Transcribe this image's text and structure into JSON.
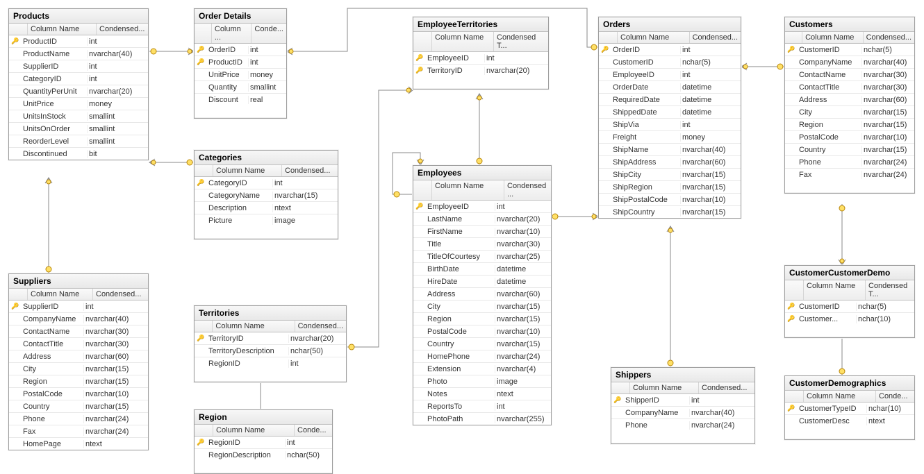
{
  "header_col1": "Column Name",
  "header_col1_short": "Column ...",
  "header_col2": "Condensed...",
  "header_col2_short": "Conde...",
  "header_col2_mid": "Condensed T...",
  "header_col2_mid2": "Condensed ...",
  "tables": {
    "products": {
      "title": "Products",
      "columns": [
        {
          "pk": true,
          "name": "ProductID",
          "type": "int"
        },
        {
          "pk": false,
          "name": "ProductName",
          "type": "nvarchar(40)"
        },
        {
          "pk": false,
          "name": "SupplierID",
          "type": "int"
        },
        {
          "pk": false,
          "name": "CategoryID",
          "type": "int"
        },
        {
          "pk": false,
          "name": "QuantityPerUnit",
          "type": "nvarchar(20)"
        },
        {
          "pk": false,
          "name": "UnitPrice",
          "type": "money"
        },
        {
          "pk": false,
          "name": "UnitsInStock",
          "type": "smallint"
        },
        {
          "pk": false,
          "name": "UnitsOnOrder",
          "type": "smallint"
        },
        {
          "pk": false,
          "name": "ReorderLevel",
          "type": "smallint"
        },
        {
          "pk": false,
          "name": "Discontinued",
          "type": "bit"
        }
      ]
    },
    "suppliers": {
      "title": "Suppliers",
      "columns": [
        {
          "pk": true,
          "name": "SupplierID",
          "type": "int"
        },
        {
          "pk": false,
          "name": "CompanyName",
          "type": "nvarchar(40)"
        },
        {
          "pk": false,
          "name": "ContactName",
          "type": "nvarchar(30)"
        },
        {
          "pk": false,
          "name": "ContactTitle",
          "type": "nvarchar(30)"
        },
        {
          "pk": false,
          "name": "Address",
          "type": "nvarchar(60)"
        },
        {
          "pk": false,
          "name": "City",
          "type": "nvarchar(15)"
        },
        {
          "pk": false,
          "name": "Region",
          "type": "nvarchar(15)"
        },
        {
          "pk": false,
          "name": "PostalCode",
          "type": "nvarchar(10)"
        },
        {
          "pk": false,
          "name": "Country",
          "type": "nvarchar(15)"
        },
        {
          "pk": false,
          "name": "Phone",
          "type": "nvarchar(24)"
        },
        {
          "pk": false,
          "name": "Fax",
          "type": "nvarchar(24)"
        },
        {
          "pk": false,
          "name": "HomePage",
          "type": "ntext"
        }
      ]
    },
    "orderdetails": {
      "title": "Order Details",
      "columns": [
        {
          "pk": true,
          "name": "OrderID",
          "type": "int"
        },
        {
          "pk": true,
          "name": "ProductID",
          "type": "int"
        },
        {
          "pk": false,
          "name": "UnitPrice",
          "type": "money"
        },
        {
          "pk": false,
          "name": "Quantity",
          "type": "smallint"
        },
        {
          "pk": false,
          "name": "Discount",
          "type": "real"
        }
      ]
    },
    "categories": {
      "title": "Categories",
      "columns": [
        {
          "pk": true,
          "name": "CategoryID",
          "type": "int"
        },
        {
          "pk": false,
          "name": "CategoryName",
          "type": "nvarchar(15)"
        },
        {
          "pk": false,
          "name": "Description",
          "type": "ntext"
        },
        {
          "pk": false,
          "name": "Picture",
          "type": "image"
        }
      ]
    },
    "territories": {
      "title": "Territories",
      "columns": [
        {
          "pk": true,
          "name": "TerritoryID",
          "type": "nvarchar(20)"
        },
        {
          "pk": false,
          "name": "TerritoryDescription",
          "type": "nchar(50)"
        },
        {
          "pk": false,
          "name": "RegionID",
          "type": "int"
        }
      ]
    },
    "region": {
      "title": "Region",
      "columns": [
        {
          "pk": true,
          "name": "RegionID",
          "type": "int"
        },
        {
          "pk": false,
          "name": "RegionDescription",
          "type": "nchar(50)"
        }
      ]
    },
    "employeeterritories": {
      "title": "EmployeeTerritories",
      "columns": [
        {
          "pk": true,
          "name": "EmployeeID",
          "type": "int"
        },
        {
          "pk": true,
          "name": "TerritoryID",
          "type": "nvarchar(20)"
        }
      ]
    },
    "employees": {
      "title": "Employees",
      "columns": [
        {
          "pk": true,
          "name": "EmployeeID",
          "type": "int"
        },
        {
          "pk": false,
          "name": "LastName",
          "type": "nvarchar(20)"
        },
        {
          "pk": false,
          "name": "FirstName",
          "type": "nvarchar(10)"
        },
        {
          "pk": false,
          "name": "Title",
          "type": "nvarchar(30)"
        },
        {
          "pk": false,
          "name": "TitleOfCourtesy",
          "type": "nvarchar(25)"
        },
        {
          "pk": false,
          "name": "BirthDate",
          "type": "datetime"
        },
        {
          "pk": false,
          "name": "HireDate",
          "type": "datetime"
        },
        {
          "pk": false,
          "name": "Address",
          "type": "nvarchar(60)"
        },
        {
          "pk": false,
          "name": "City",
          "type": "nvarchar(15)"
        },
        {
          "pk": false,
          "name": "Region",
          "type": "nvarchar(15)"
        },
        {
          "pk": false,
          "name": "PostalCode",
          "type": "nvarchar(10)"
        },
        {
          "pk": false,
          "name": "Country",
          "type": "nvarchar(15)"
        },
        {
          "pk": false,
          "name": "HomePhone",
          "type": "nvarchar(24)"
        },
        {
          "pk": false,
          "name": "Extension",
          "type": "nvarchar(4)"
        },
        {
          "pk": false,
          "name": "Photo",
          "type": "image"
        },
        {
          "pk": false,
          "name": "Notes",
          "type": "ntext"
        },
        {
          "pk": false,
          "name": "ReportsTo",
          "type": "int"
        },
        {
          "pk": false,
          "name": "PhotoPath",
          "type": "nvarchar(255)"
        }
      ]
    },
    "orders": {
      "title": "Orders",
      "columns": [
        {
          "pk": true,
          "name": "OrderID",
          "type": "int"
        },
        {
          "pk": false,
          "name": "CustomerID",
          "type": "nchar(5)"
        },
        {
          "pk": false,
          "name": "EmployeeID",
          "type": "int"
        },
        {
          "pk": false,
          "name": "OrderDate",
          "type": "datetime"
        },
        {
          "pk": false,
          "name": "RequiredDate",
          "type": "datetime"
        },
        {
          "pk": false,
          "name": "ShippedDate",
          "type": "datetime"
        },
        {
          "pk": false,
          "name": "ShipVia",
          "type": "int"
        },
        {
          "pk": false,
          "name": "Freight",
          "type": "money"
        },
        {
          "pk": false,
          "name": "ShipName",
          "type": "nvarchar(40)"
        },
        {
          "pk": false,
          "name": "ShipAddress",
          "type": "nvarchar(60)"
        },
        {
          "pk": false,
          "name": "ShipCity",
          "type": "nvarchar(15)"
        },
        {
          "pk": false,
          "name": "ShipRegion",
          "type": "nvarchar(15)"
        },
        {
          "pk": false,
          "name": "ShipPostalCode",
          "type": "nvarchar(10)"
        },
        {
          "pk": false,
          "name": "ShipCountry",
          "type": "nvarchar(15)"
        }
      ]
    },
    "shippers": {
      "title": "Shippers",
      "columns": [
        {
          "pk": true,
          "name": "ShipperID",
          "type": "int"
        },
        {
          "pk": false,
          "name": "CompanyName",
          "type": "nvarchar(40)"
        },
        {
          "pk": false,
          "name": "Phone",
          "type": "nvarchar(24)"
        }
      ]
    },
    "customers": {
      "title": "Customers",
      "columns": [
        {
          "pk": true,
          "name": "CustomerID",
          "type": "nchar(5)"
        },
        {
          "pk": false,
          "name": "CompanyName",
          "type": "nvarchar(40)"
        },
        {
          "pk": false,
          "name": "ContactName",
          "type": "nvarchar(30)"
        },
        {
          "pk": false,
          "name": "ContactTitle",
          "type": "nvarchar(30)"
        },
        {
          "pk": false,
          "name": "Address",
          "type": "nvarchar(60)"
        },
        {
          "pk": false,
          "name": "City",
          "type": "nvarchar(15)"
        },
        {
          "pk": false,
          "name": "Region",
          "type": "nvarchar(15)"
        },
        {
          "pk": false,
          "name": "PostalCode",
          "type": "nvarchar(10)"
        },
        {
          "pk": false,
          "name": "Country",
          "type": "nvarchar(15)"
        },
        {
          "pk": false,
          "name": "Phone",
          "type": "nvarchar(24)"
        },
        {
          "pk": false,
          "name": "Fax",
          "type": "nvarchar(24)"
        }
      ]
    },
    "customercustomerdemo": {
      "title": "CustomerCustomerDemo",
      "columns": [
        {
          "pk": true,
          "name": "CustomerID",
          "type": "nchar(5)"
        },
        {
          "pk": true,
          "name": "Customer...",
          "type": "nchar(10)"
        }
      ]
    },
    "customerdemographics": {
      "title": "CustomerDemographics",
      "columns": [
        {
          "pk": true,
          "name": "CustomerTypeID",
          "type": "nchar(10)"
        },
        {
          "pk": false,
          "name": "CustomerDesc",
          "type": "ntext"
        }
      ]
    }
  },
  "relationships": [
    {
      "from": "Products.SupplierID",
      "to": "Suppliers.SupplierID"
    },
    {
      "from": "Products.CategoryID",
      "to": "Categories.CategoryID"
    },
    {
      "from": "OrderDetails.ProductID",
      "to": "Products.ProductID"
    },
    {
      "from": "OrderDetails.OrderID",
      "to": "Orders.OrderID"
    },
    {
      "from": "Territories.RegionID",
      "to": "Region.RegionID"
    },
    {
      "from": "EmployeeTerritories.TerritoryID",
      "to": "Territories.TerritoryID"
    },
    {
      "from": "EmployeeTerritories.EmployeeID",
      "to": "Employees.EmployeeID"
    },
    {
      "from": "Employees.ReportsTo",
      "to": "Employees.EmployeeID"
    },
    {
      "from": "Orders.EmployeeID",
      "to": "Employees.EmployeeID"
    },
    {
      "from": "Orders.CustomerID",
      "to": "Customers.CustomerID"
    },
    {
      "from": "Orders.ShipVia",
      "to": "Shippers.ShipperID"
    },
    {
      "from": "CustomerCustomerDemo.CustomerID",
      "to": "Customers.CustomerID"
    },
    {
      "from": "CustomerCustomerDemo.CustomerTypeID",
      "to": "CustomerDemographics.CustomerTypeID"
    }
  ]
}
